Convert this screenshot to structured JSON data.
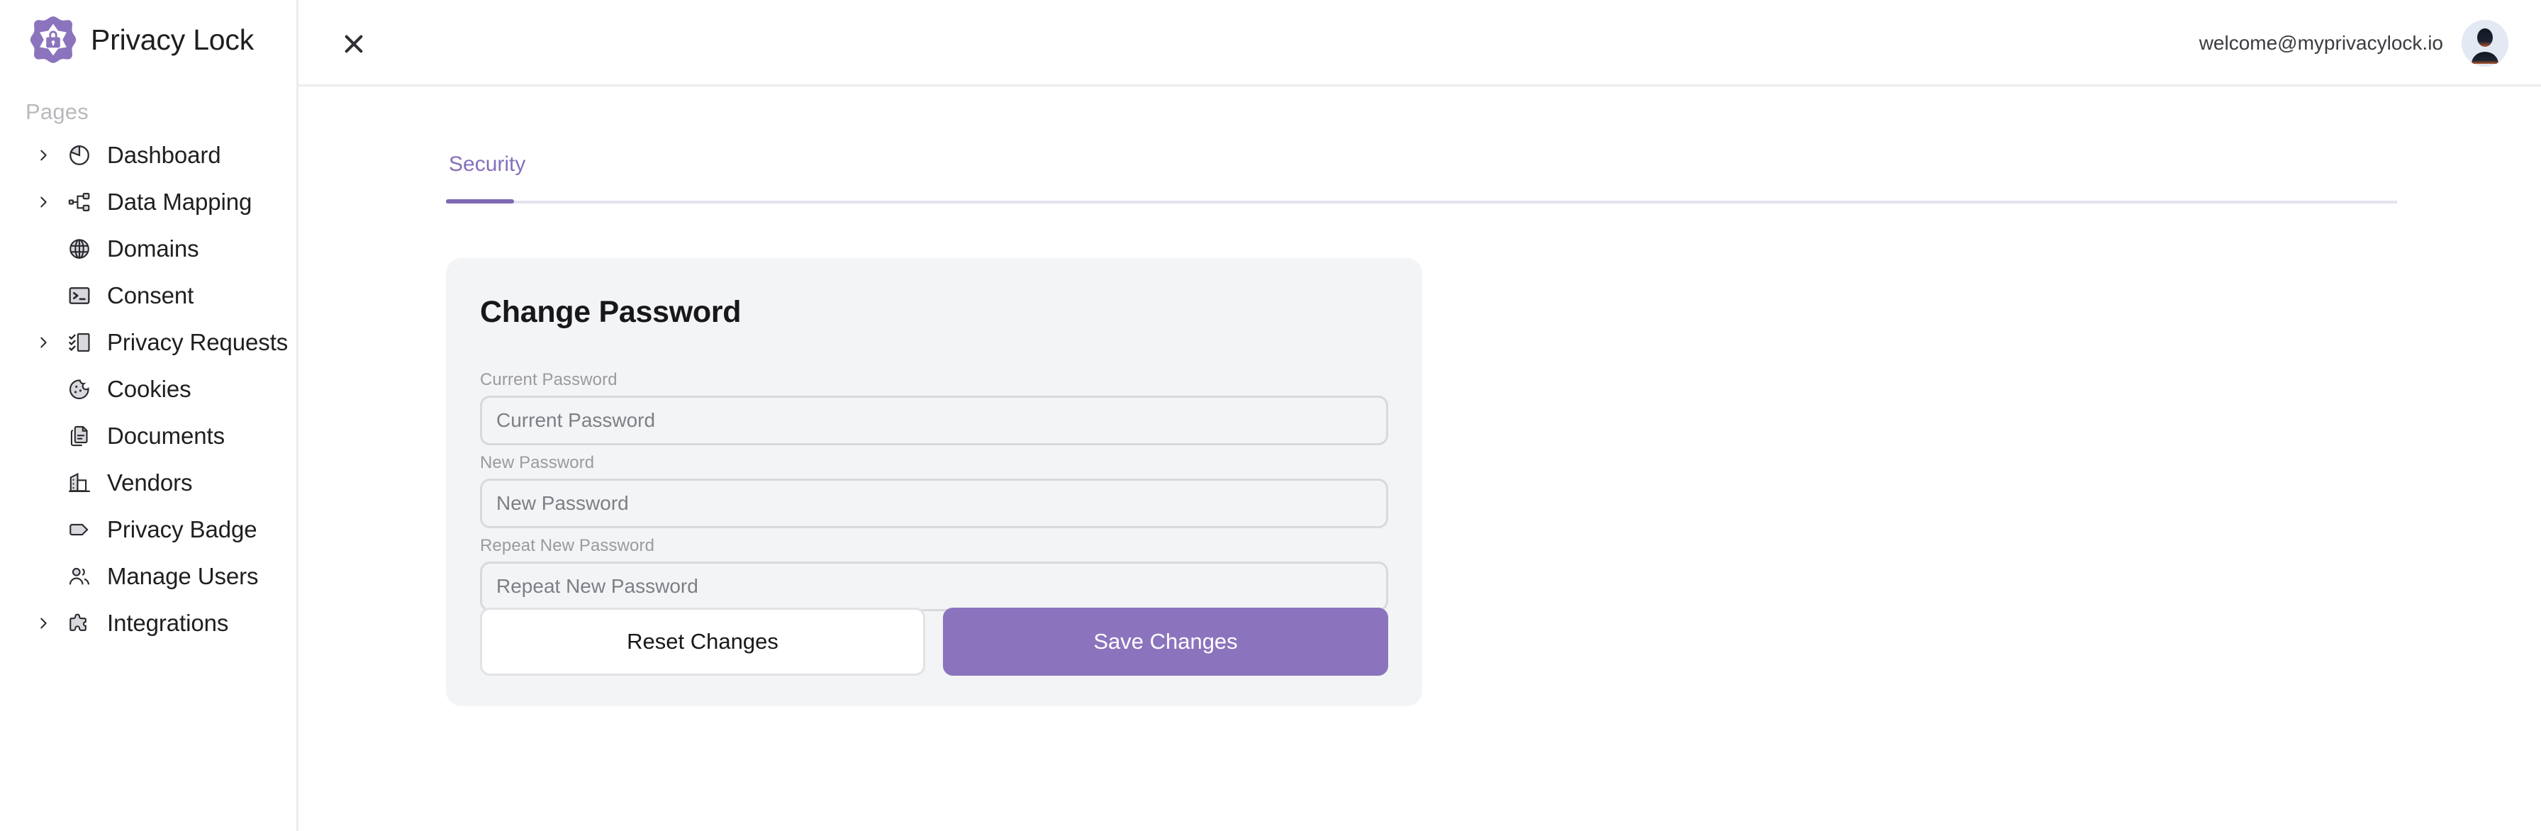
{
  "brand": {
    "name": "Privacy Lock",
    "logo_icon": "privacy-lock-badge-icon",
    "accent_color": "#8b74bd"
  },
  "header": {
    "close_icon": "close-icon",
    "user_email": "welcome@myprivacylock.io",
    "avatar_icon": "user-avatar"
  },
  "sidebar": {
    "section_label": "Pages",
    "items": [
      {
        "label": "Dashboard",
        "icon": "pie-chart-icon",
        "expandable": true
      },
      {
        "label": "Data Mapping",
        "icon": "sitemap-icon",
        "expandable": true
      },
      {
        "label": "Domains",
        "icon": "globe-icon",
        "expandable": false
      },
      {
        "label": "Consent",
        "icon": "terminal-icon",
        "expandable": false
      },
      {
        "label": "Privacy Requests",
        "icon": "checklist-icon",
        "expandable": true
      },
      {
        "label": "Cookies",
        "icon": "cookie-icon",
        "expandable": false
      },
      {
        "label": "Documents",
        "icon": "documents-icon",
        "expandable": false
      },
      {
        "label": "Vendors",
        "icon": "building-icon",
        "expandable": false
      },
      {
        "label": "Privacy Badge",
        "icon": "tag-icon",
        "expandable": false
      },
      {
        "label": "Manage Users",
        "icon": "users-icon",
        "expandable": false
      },
      {
        "label": "Integrations",
        "icon": "puzzle-icon",
        "expandable": true
      }
    ]
  },
  "main": {
    "tabs": [
      {
        "label": "Security",
        "active": true
      }
    ],
    "card": {
      "title": "Change Password",
      "fields": [
        {
          "label": "Current Password",
          "placeholder": "Current Password",
          "value": ""
        },
        {
          "label": "New Password",
          "placeholder": "New Password",
          "value": ""
        },
        {
          "label": "Repeat New Password",
          "placeholder": "Repeat New Password",
          "value": ""
        }
      ],
      "reset_label": "Reset Changes",
      "save_label": "Save Changes"
    }
  }
}
